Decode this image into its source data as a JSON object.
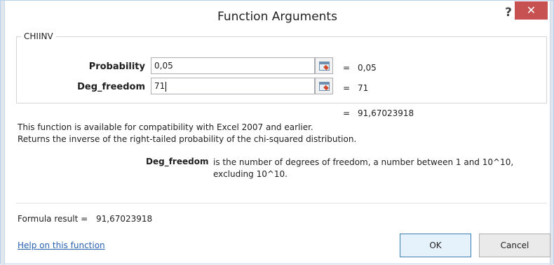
{
  "dialog": {
    "title": "Function Arguments",
    "help_button": "?",
    "close_button": "✕"
  },
  "function": {
    "name": "CHIINV",
    "arguments": [
      {
        "label": "Probability",
        "value": "0,05",
        "result": "0,05"
      },
      {
        "label": "Deg_freedom",
        "value": "71",
        "result": "71"
      }
    ],
    "result": "91,67023918"
  },
  "equals": "=",
  "description": {
    "line1": "This function is available for compatibility with Excel 2007 and earlier.",
    "line2": "Returns the inverse of the right-tailed probability of the chi-squared distribution."
  },
  "argument_help": {
    "name": "Deg_freedom",
    "text": "is the number of degrees of freedom, a number between 1 and 10^10, excluding 10^10."
  },
  "formula_result": {
    "label": "Formula result =",
    "value": "91,67023918"
  },
  "footer": {
    "help_link": "Help on this function",
    "ok_label": "OK",
    "cancel_label": "Cancel"
  },
  "colors": {
    "close_button": "#c75050",
    "link": "#2862b3"
  }
}
